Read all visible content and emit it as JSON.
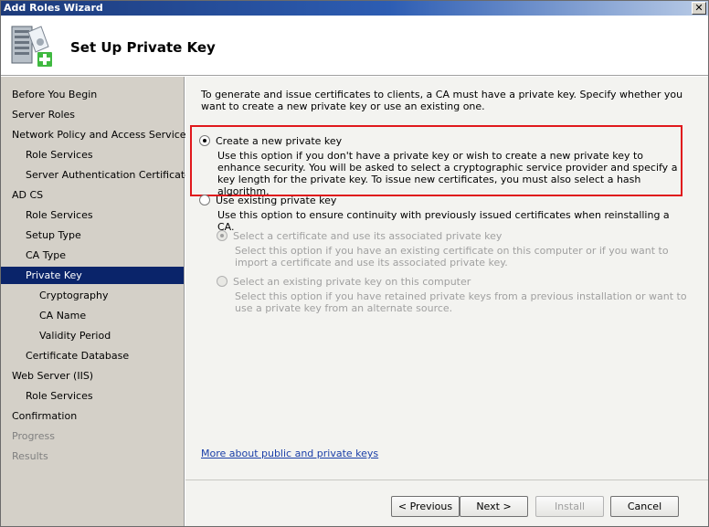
{
  "window": {
    "title": "Add Roles Wizard",
    "close_glyph": "✕"
  },
  "header": {
    "title": "Set Up Private Key",
    "icon": "server-add-icon"
  },
  "sidebar": {
    "items": [
      {
        "label": "Before You Begin",
        "indent": 0,
        "state": "normal"
      },
      {
        "label": "Server Roles",
        "indent": 0,
        "state": "normal"
      },
      {
        "label": "Network Policy and Access Services",
        "indent": 0,
        "state": "normal"
      },
      {
        "label": "Role Services",
        "indent": 1,
        "state": "normal"
      },
      {
        "label": "Server Authentication Certificate",
        "indent": 1,
        "state": "normal"
      },
      {
        "label": "AD CS",
        "indent": 0,
        "state": "normal"
      },
      {
        "label": "Role Services",
        "indent": 1,
        "state": "normal"
      },
      {
        "label": "Setup Type",
        "indent": 1,
        "state": "normal"
      },
      {
        "label": "CA Type",
        "indent": 1,
        "state": "normal"
      },
      {
        "label": "Private Key",
        "indent": 1,
        "state": "selected"
      },
      {
        "label": "Cryptography",
        "indent": 2,
        "state": "normal"
      },
      {
        "label": "CA Name",
        "indent": 2,
        "state": "normal"
      },
      {
        "label": "Validity Period",
        "indent": 2,
        "state": "normal"
      },
      {
        "label": "Certificate Database",
        "indent": 1,
        "state": "normal"
      },
      {
        "label": "Web Server (IIS)",
        "indent": 0,
        "state": "normal"
      },
      {
        "label": "Role Services",
        "indent": 1,
        "state": "normal"
      },
      {
        "label": "Confirmation",
        "indent": 0,
        "state": "normal"
      },
      {
        "label": "Progress",
        "indent": 0,
        "state": "disabled"
      },
      {
        "label": "Results",
        "indent": 0,
        "state": "disabled"
      }
    ]
  },
  "main": {
    "intro": "To generate and issue certificates to clients, a CA must have a private key. Specify whether you want to create a new private key or use an existing one.",
    "option_new": {
      "label": "Create a new private key",
      "desc": "Use this option if you don't have a private key or wish to create a new private key to enhance security. You will be asked to select a cryptographic service provider and specify a key length for the private key. To issue new certificates, you must also select a hash algorithm.",
      "selected": true
    },
    "option_existing": {
      "label": "Use existing private key",
      "desc": "Use this option to ensure continuity with previously issued certificates when reinstalling a CA.",
      "selected": false
    },
    "sub_option_cert": {
      "label": "Select a certificate and use its associated private key",
      "desc": "Select this option if you have an existing certificate on this computer or if you want to import a certificate and use its associated private key.",
      "selected": true
    },
    "sub_option_key": {
      "label": "Select an existing private key on this computer",
      "desc": "Select this option if you have retained private keys from a previous installation or want to use a private key from an alternate source.",
      "selected": false
    },
    "link": "More about public and private keys"
  },
  "footer": {
    "previous": "< Previous",
    "next": "Next >",
    "install": "Install",
    "cancel": "Cancel"
  }
}
